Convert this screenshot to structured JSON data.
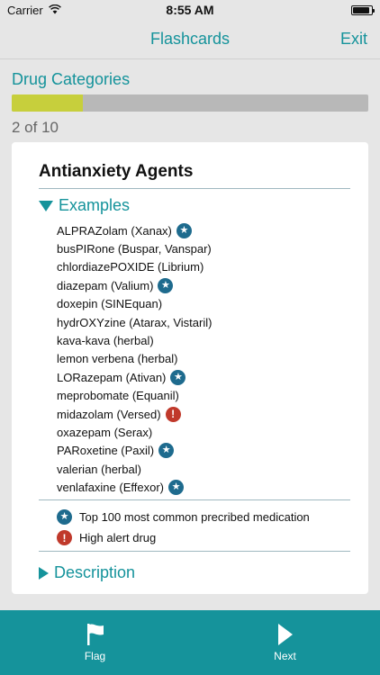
{
  "status_bar": {
    "carrier": "Carrier",
    "time": "8:55 AM",
    "icons": [
      "wifi-icon",
      "battery-icon"
    ],
    "battery_level": 0.9
  },
  "nav": {
    "title": "Flashcards",
    "exit_label": "Exit"
  },
  "category": {
    "title": "Drug Categories",
    "progress_text": "2 of 10",
    "progress_fraction": 0.2
  },
  "card": {
    "title": "Antianxiety Agents",
    "examples_header": "Examples",
    "examples": [
      {
        "name": "ALPRAZolam (Xanax)",
        "badge": "star"
      },
      {
        "name": "busPIRone (Buspar, Vanspar)",
        "badge": ""
      },
      {
        "name": "chlordiazePOXIDE (Librium)",
        "badge": ""
      },
      {
        "name": "diazepam (Valium)",
        "badge": "star"
      },
      {
        "name": "doxepin (SINEquan)",
        "badge": ""
      },
      {
        "name": "hydrOXYzine (Atarax, Vistaril)",
        "badge": ""
      },
      {
        "name": "kava-kava (herbal)",
        "badge": ""
      },
      {
        "name": "lemon verbena (herbal)",
        "badge": ""
      },
      {
        "name": "LORazepam (Ativan)",
        "badge": "star"
      },
      {
        "name": "meprobomate (Equanil)",
        "badge": ""
      },
      {
        "name": "midazolam (Versed)",
        "badge": "alert"
      },
      {
        "name": "oxazepam (Serax)",
        "badge": ""
      },
      {
        "name": "PARoxetine (Paxil)",
        "badge": "star"
      },
      {
        "name": "valerian (herbal)",
        "badge": ""
      },
      {
        "name": "venlafaxine (Effexor)",
        "badge": "star"
      }
    ],
    "legend": [
      {
        "badge": "star",
        "text": "Top 100 most common precribed medication"
      },
      {
        "badge": "alert",
        "text": "High alert drug"
      }
    ],
    "description_header": "Description"
  },
  "toolbar": {
    "flag_label": "Flag",
    "next_label": "Next"
  },
  "colors": {
    "accent": "#15939b",
    "progress": "#c7cf3c",
    "star_badge": "#1e6b8e",
    "alert_badge": "#c0392b"
  }
}
